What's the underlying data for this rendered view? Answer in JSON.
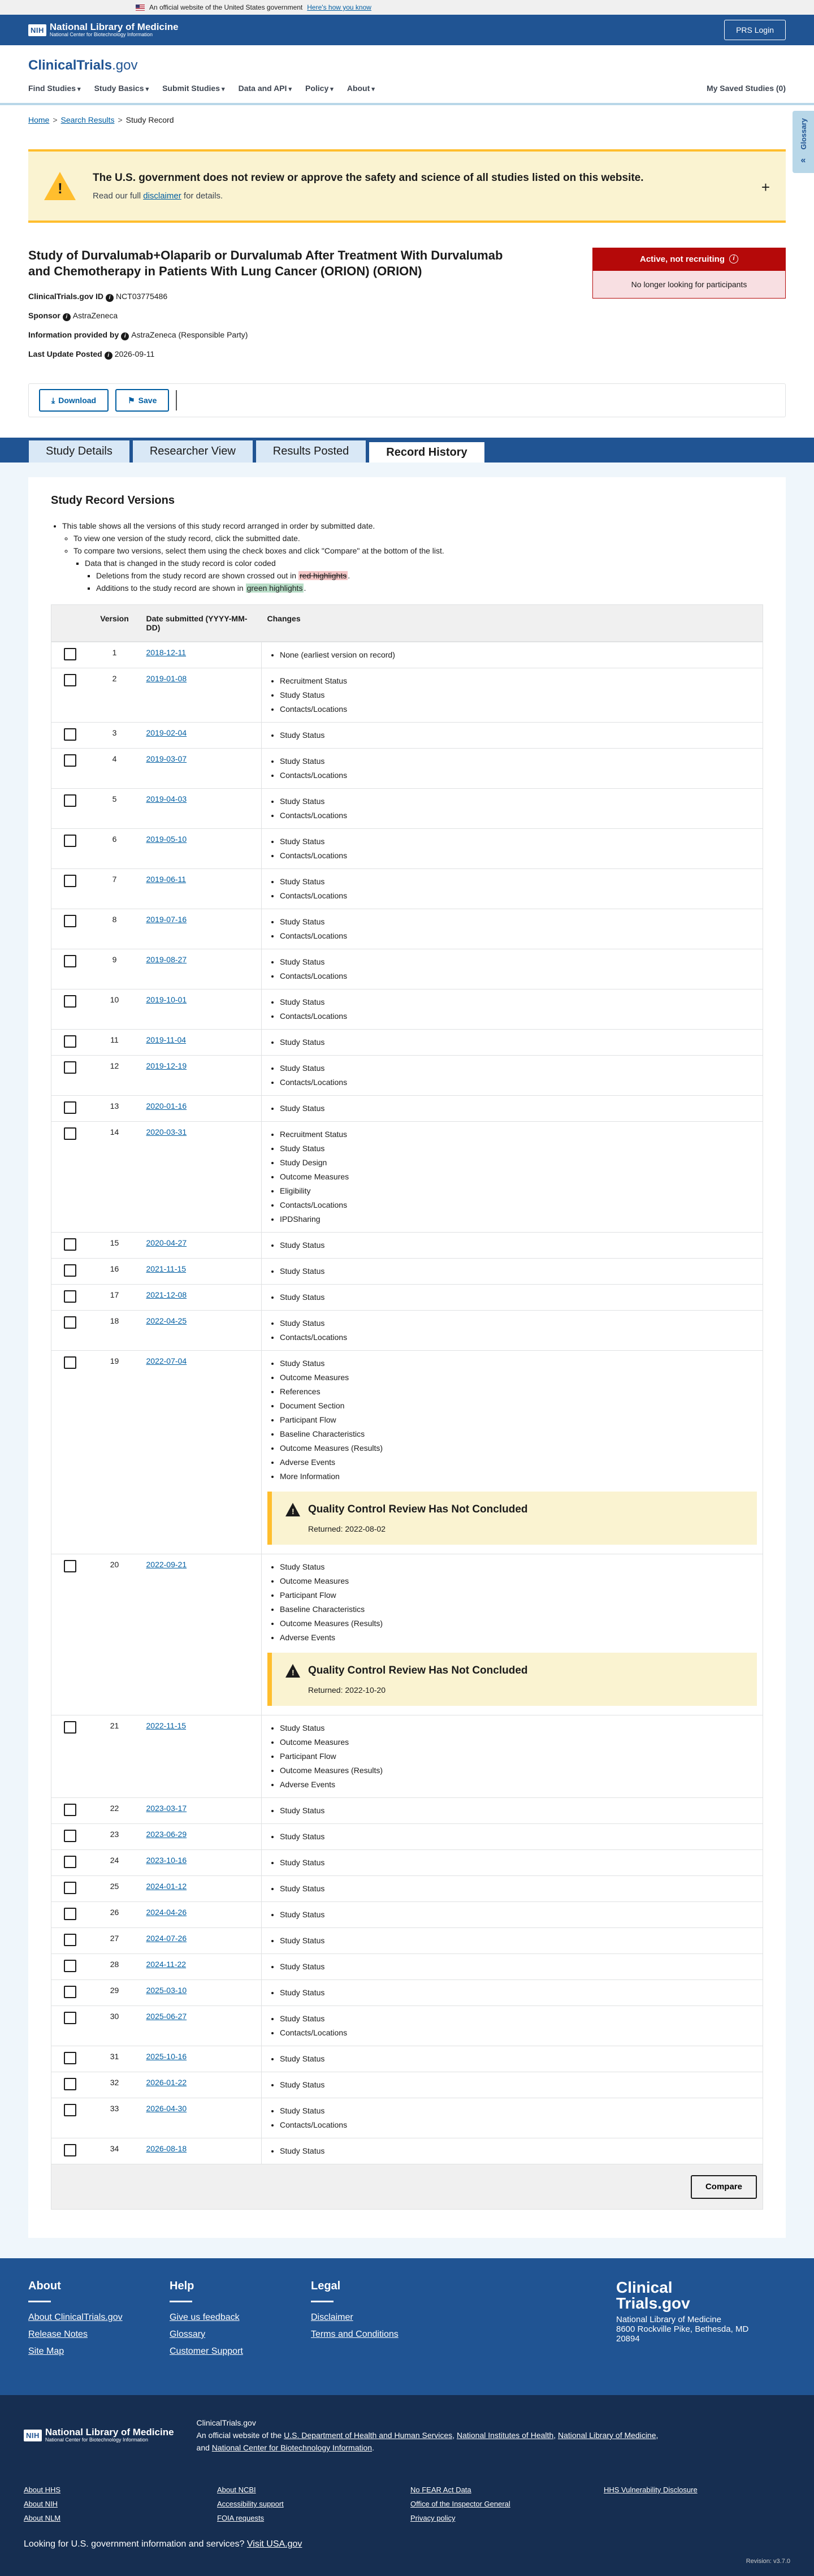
{
  "gov_banner": {
    "text": "An official website of the United States government",
    "link": "Here's how you know"
  },
  "nlm": {
    "nih": "NIH",
    "title": "National Library of Medicine",
    "subtitle": "National Center for Biotechnology Information",
    "prs_login": "PRS Login"
  },
  "site": {
    "name": "ClinicalTrials",
    "dot_gov": ".gov"
  },
  "nav": {
    "items": [
      "Find Studies",
      "Study Basics",
      "Submit Studies",
      "Data and API",
      "Policy",
      "About"
    ],
    "saved": "My Saved Studies (0)"
  },
  "breadcrumb": {
    "home": "Home",
    "search": "Search Results",
    "current": "Study Record"
  },
  "glossary": "Glossary",
  "notice": {
    "title": "The U.S. government does not review or approve the safety and science of all studies listed on this website.",
    "text_before": "Read our full",
    "link": "disclaimer",
    "text_after": "for details."
  },
  "study": {
    "title": "Study of Durvalumab+Olaparib or Durvalumab After Treatment With Durvalumab and Chemotherapy in Patients With Lung Cancer (ORION) (ORION)",
    "id_label": "ClinicalTrials.gov ID",
    "id": "NCT03775486",
    "sponsor_label": "Sponsor",
    "sponsor": "AstraZeneca",
    "provided_label": "Information provided by",
    "provided": "AstraZeneca (Responsible Party)",
    "update_label": "Last Update Posted",
    "update": "2026-09-11",
    "status": "Active, not recruiting",
    "status_sub": "No longer looking for participants"
  },
  "actions": {
    "download": "Download",
    "save": "Save"
  },
  "tabs": [
    "Study Details",
    "Researcher View",
    "Results Posted",
    "Record History"
  ],
  "history": {
    "heading": "Study Record Versions",
    "intro": {
      "l1": "This table shows all the versions of this study record arranged in order by submitted date.",
      "l2": "To view one version of the study record, click the submitted date.",
      "l3": "To compare two versions, select them using the check boxes and click \"Compare\" at the bottom of the list.",
      "l4": "Data that is changed in the study record is color coded",
      "l5a": "Deletions from the study record are shown crossed out in",
      "l5b": "red highlights",
      "l5c": ".",
      "l6a": "Additions to the study record are shown in",
      "l6b": "green highlights",
      "l6c": "."
    },
    "col_version": "Version",
    "col_date": "Date submitted (YYYY-MM-DD)",
    "col_changes": "Changes",
    "qc_title": "Quality Control Review Has Not Concluded",
    "compare": "Compare",
    "rows": [
      {
        "v": "1",
        "d": "2018-12-11",
        "c": [
          "None (earliest version on record)"
        ]
      },
      {
        "v": "2",
        "d": "2019-01-08",
        "c": [
          "Recruitment Status",
          "Study Status",
          "Contacts/Locations"
        ]
      },
      {
        "v": "3",
        "d": "2019-02-04",
        "c": [
          "Study Status"
        ]
      },
      {
        "v": "4",
        "d": "2019-03-07",
        "c": [
          "Study Status",
          "Contacts/Locations"
        ]
      },
      {
        "v": "5",
        "d": "2019-04-03",
        "c": [
          "Study Status",
          "Contacts/Locations"
        ]
      },
      {
        "v": "6",
        "d": "2019-05-10",
        "c": [
          "Study Status",
          "Contacts/Locations"
        ]
      },
      {
        "v": "7",
        "d": "2019-06-11",
        "c": [
          "Study Status",
          "Contacts/Locations"
        ]
      },
      {
        "v": "8",
        "d": "2019-07-16",
        "c": [
          "Study Status",
          "Contacts/Locations"
        ]
      },
      {
        "v": "9",
        "d": "2019-08-27",
        "c": [
          "Study Status",
          "Contacts/Locations"
        ]
      },
      {
        "v": "10",
        "d": "2019-10-01",
        "c": [
          "Study Status",
          "Contacts/Locations"
        ]
      },
      {
        "v": "11",
        "d": "2019-11-04",
        "c": [
          "Study Status"
        ]
      },
      {
        "v": "12",
        "d": "2019-12-19",
        "c": [
          "Study Status",
          "Contacts/Locations"
        ]
      },
      {
        "v": "13",
        "d": "2020-01-16",
        "c": [
          "Study Status"
        ]
      },
      {
        "v": "14",
        "d": "2020-03-31",
        "c": [
          "Recruitment Status",
          "Study Status",
          "Study Design",
          "Outcome Measures",
          "Eligibility",
          "Contacts/Locations",
          "IPDSharing"
        ]
      },
      {
        "v": "15",
        "d": "2020-04-27",
        "c": [
          "Study Status"
        ]
      },
      {
        "v": "16",
        "d": "2021-11-15",
        "c": [
          "Study Status"
        ]
      },
      {
        "v": "17",
        "d": "2021-12-08",
        "c": [
          "Study Status"
        ]
      },
      {
        "v": "18",
        "d": "2022-04-25",
        "c": [
          "Study Status",
          "Contacts/Locations"
        ]
      },
      {
        "v": "19",
        "d": "2022-07-04",
        "c": [
          "Study Status",
          "Outcome Measures",
          "References",
          "Document Section",
          "Participant Flow",
          "Baseline Characteristics",
          "Outcome Measures (Results)",
          "Adverse Events",
          "More Information"
        ],
        "qc": "Returned: 2022-08-02"
      },
      {
        "v": "20",
        "d": "2022-09-21",
        "c": [
          "Study Status",
          "Outcome Measures",
          "Participant Flow",
          "Baseline Characteristics",
          "Outcome Measures (Results)",
          "Adverse Events"
        ],
        "qc": "Returned: 2022-10-20"
      },
      {
        "v": "21",
        "d": "2022-11-15",
        "c": [
          "Study Status",
          "Outcome Measures",
          "Participant Flow",
          "Outcome Measures (Results)",
          "Adverse Events"
        ]
      },
      {
        "v": "22",
        "d": "2023-03-17",
        "c": [
          "Study Status"
        ]
      },
      {
        "v": "23",
        "d": "2023-06-29",
        "c": [
          "Study Status"
        ]
      },
      {
        "v": "24",
        "d": "2023-10-16",
        "c": [
          "Study Status"
        ]
      },
      {
        "v": "25",
        "d": "2024-01-12",
        "c": [
          "Study Status"
        ]
      },
      {
        "v": "26",
        "d": "2024-04-26",
        "c": [
          "Study Status"
        ]
      },
      {
        "v": "27",
        "d": "2024-07-26",
        "c": [
          "Study Status"
        ]
      },
      {
        "v": "28",
        "d": "2024-11-22",
        "c": [
          "Study Status"
        ]
      },
      {
        "v": "29",
        "d": "2025-03-10",
        "c": [
          "Study Status"
        ]
      },
      {
        "v": "30",
        "d": "2025-06-27",
        "c": [
          "Study Status",
          "Contacts/Locations"
        ]
      },
      {
        "v": "31",
        "d": "2025-10-16",
        "c": [
          "Study Status"
        ]
      },
      {
        "v": "32",
        "d": "2026-01-22",
        "c": [
          "Study Status"
        ]
      },
      {
        "v": "33",
        "d": "2026-04-30",
        "c": [
          "Study Status",
          "Contacts/Locations"
        ]
      },
      {
        "v": "34",
        "d": "2026-08-18",
        "c": [
          "Study Status"
        ]
      }
    ]
  },
  "footer": {
    "about": {
      "heading": "About",
      "links": [
        "About ClinicalTrials.gov",
        "Release Notes",
        "Site Map"
      ]
    },
    "help": {
      "heading": "Help",
      "links": [
        "Give us feedback",
        "Glossary",
        "Customer Support"
      ]
    },
    "legal": {
      "heading": "Legal",
      "links": [
        "Disclaimer",
        "Terms and Conditions"
      ]
    },
    "logo_line1": "Clinical",
    "logo_line2": "Trials.gov",
    "address": [
      "National Library of Medicine",
      "8600 Rockville Pike, Bethesda, MD",
      "20894"
    ]
  },
  "footer2": {
    "site": "ClinicalTrials.gov",
    "official": "An official website of the",
    "hhs": "U.S. Department of Health and Human Services",
    "nih": "National Institutes of Health",
    "nlm": "National Library of Medicine",
    "and": "and",
    "ncbi": "National Center for Biotechnology Information",
    "links": [
      "About HHS",
      "About NCBI",
      "No FEAR Act Data",
      "HHS Vulnerability Disclosure",
      "About NIH",
      "Accessibility support",
      "Office of the Inspector General",
      "",
      "About NLM",
      "FOIA requests",
      "Privacy policy",
      ""
    ],
    "usa_q": "Looking for U.S. government information and services?",
    "usa_link": "Visit USA.gov",
    "revision": "Revision: v3.7.0"
  }
}
